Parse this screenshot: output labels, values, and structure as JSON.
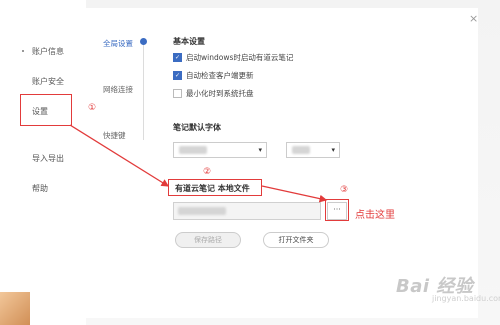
{
  "sidebar": {
    "items": [
      {
        "label": "账户信息",
        "bullet": true
      },
      {
        "label": "账户安全",
        "bullet": false
      },
      {
        "label": "设置",
        "bullet": false,
        "selected": true
      },
      {
        "label": "导入导出",
        "bullet": false
      },
      {
        "label": "帮助",
        "bullet": false
      }
    ]
  },
  "timeline": {
    "items": [
      "全局设置",
      "网络连接",
      "快捷键"
    ]
  },
  "basic": {
    "title": "基本设置",
    "options": [
      {
        "label": "启动windows时启动有道云笔记",
        "checked": true
      },
      {
        "label": "自动检查客户端更新",
        "checked": true
      },
      {
        "label": "最小化时到系统托盘",
        "checked": false
      }
    ]
  },
  "font": {
    "title": "笔记默认字体",
    "caret": "▾"
  },
  "file": {
    "title": "有道云笔记 本地文件",
    "browse_label": "···",
    "save_path_label": "保存路径",
    "open_folder_label": "打开文件夹"
  },
  "close_label": "×",
  "annotations": {
    "num1": "①",
    "num2": "②",
    "num3": "③",
    "click_here": "点击这里"
  },
  "watermark": {
    "text": "Bai  经验",
    "sub": "jingyan.baidu.com"
  },
  "colors": {
    "accent": "#3b6cc2",
    "annotation": "#e23b3b"
  }
}
